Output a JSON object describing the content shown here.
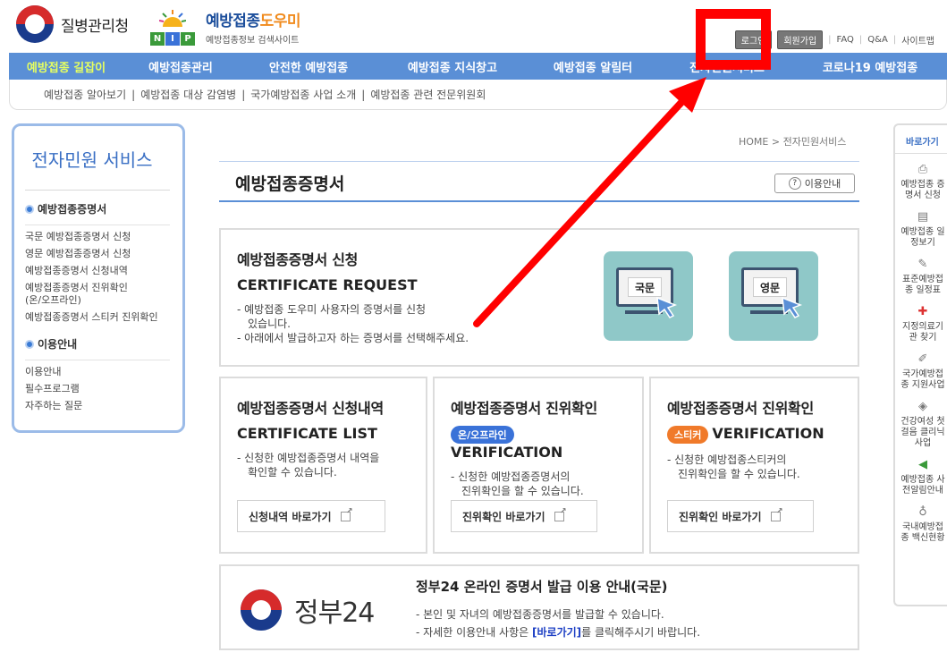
{
  "header": {
    "org_name": "질병관리청",
    "site_title_main": "예방접종",
    "site_title_accent": "도우미",
    "site_subtitle": "예방접종정보 검색사이트",
    "nip_letters": [
      "N",
      "I",
      "P"
    ],
    "util": {
      "login": "로그인",
      "join": "회원가입",
      "faq": "FAQ",
      "qna": "Q&A",
      "sitemap": "사이트맵"
    }
  },
  "gnb": {
    "items": [
      "예방접종 길잡이",
      "예방접종관리",
      "안전한 예방접종",
      "예방접종 지식창고",
      "예방접종 알림터",
      "전자민원서비스",
      "코로나19 예방접종"
    ]
  },
  "subnav": {
    "items": [
      "예방접종 알아보기",
      "예방접종 대상 감염병",
      "국가예방접종 사업 소개",
      "예방접종 관련 전문위원회"
    ]
  },
  "sidebar": {
    "title": "전자민원 서비스",
    "section1": "예방접종증명서",
    "items1": [
      "국문 예방접종증명서 신청",
      "영문 예방접종증명서 신청",
      "예방접종증명서 신청내역",
      "예방접종증명서 진위확인 (온/오프라인)",
      "예방접종증명서 스티커 진위확인"
    ],
    "section2": "이용안내",
    "items2": [
      "이용안내",
      "필수프로그램",
      "자주하는 질문"
    ]
  },
  "main": {
    "breadcrumb": "HOME > 전자민원서비스",
    "page_title": "예방접종증명서",
    "guide_label": "이용안내",
    "request": {
      "title": "예방접종증명서 신청",
      "en": "CERTIFICATE REQUEST",
      "desc1": "- 예방접종 도우미 사용자의 증명서를 신청",
      "desc1b": "있습니다.",
      "desc2": "- 아래에서 발급하고자 하는 증명서를 선택해주세요.",
      "btn_kr": "국문",
      "btn_en": "영문"
    },
    "list": {
      "title": "예방접종증명서 신청내역",
      "en": "CERTIFICATE LIST",
      "desc1": "- 신청한 예방접종증명서 내역을",
      "desc2": "확인할 수 있습니다.",
      "link": "신청내역 바로가기"
    },
    "verify": {
      "title": "예방접종증명서 진위확인",
      "pill": "온/오프라인",
      "en": "VERIFICATION",
      "desc1": "- 신청한 예방접종증명서의",
      "desc2": "진위확인을 할 수 있습니다.",
      "link": "진위확인 바로가기"
    },
    "sticker": {
      "title": "예방접종증명서 진위확인",
      "pill": "스티커",
      "en": "VERIFICATION",
      "desc1": "- 신청한 예방접종스티커의",
      "desc2": "진위확인을 할 수 있습니다.",
      "link": "진위확인 바로가기"
    },
    "gov24": {
      "logo_text": "정부24",
      "title": "정부24 온라인 증명서 발급 이용 안내(국문)",
      "desc1": "- 본인 및 자녀의 예방접종증명서를 발급할 수 있습니다.",
      "desc2_pre": "- 자세한 이용안내 사항은 ",
      "desc2_link": "[바로가기]",
      "desc2_post": "를 클릭해주시기 바랍니다."
    }
  },
  "quick": {
    "title": "바로가기",
    "items": [
      "예방접종 증명서 신청",
      "예방접종 일정보기",
      "표준예방접종 일정표",
      "지정의료기관 찾기",
      "국가예방접종 지원사업",
      "건강여성 첫걸음 클리닉사업",
      "예방접종 사전알림안내",
      "국내예방접종 백신현황"
    ]
  },
  "colors": {
    "gnb": "#5a8fd6",
    "gnb_active": "#e6ff60",
    "pill_blue": "#3a72d8",
    "pill_orange": "#f07a2a",
    "highlight": "#ff0000"
  }
}
